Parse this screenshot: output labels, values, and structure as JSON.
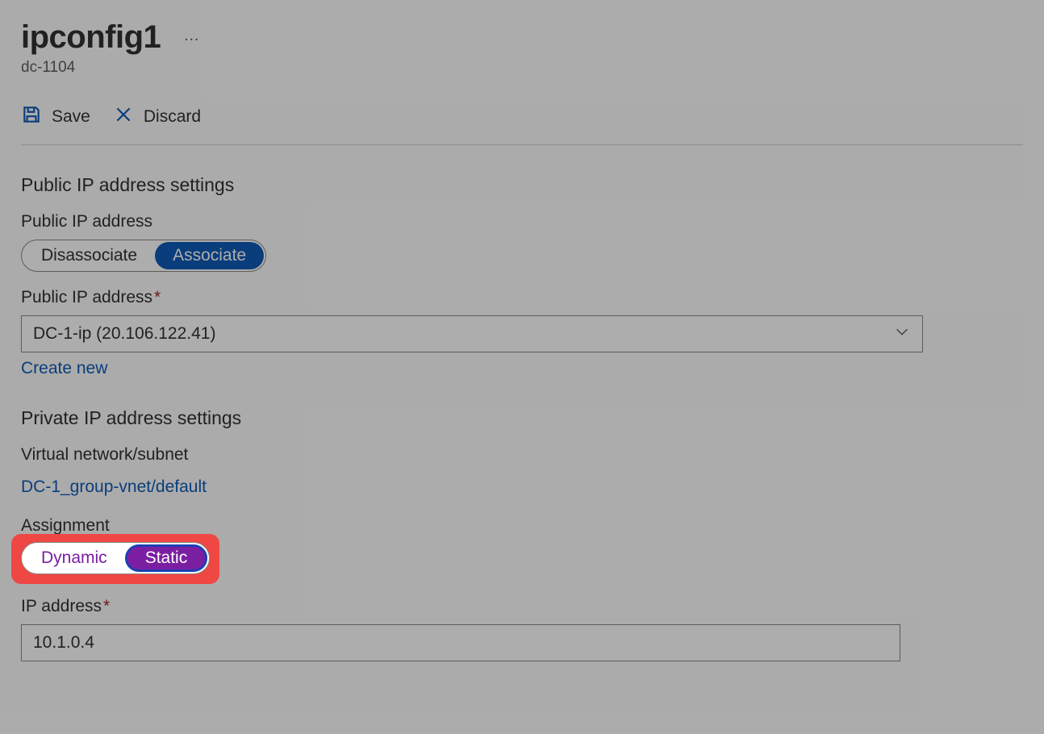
{
  "header": {
    "title": "ipconfig1",
    "subtitle": "dc-1104",
    "more": "…"
  },
  "toolbar": {
    "save_label": "Save",
    "discard_label": "Discard"
  },
  "public_ip": {
    "section_heading": "Public IP address settings",
    "toggle_label": "Public IP address",
    "disassociate": "Disassociate",
    "associate": "Associate",
    "dropdown_label": "Public IP address",
    "dropdown_value": "DC-1-ip (20.106.122.41)",
    "create_new": "Create new"
  },
  "private_ip": {
    "section_heading": "Private IP address settings",
    "vnet_label": "Virtual network/subnet",
    "vnet_value": "DC-1_group-vnet/default",
    "assignment_label": "Assignment",
    "dynamic": "Dynamic",
    "static": "Static",
    "ip_label": "IP address",
    "ip_value": "10.1.0.4"
  }
}
